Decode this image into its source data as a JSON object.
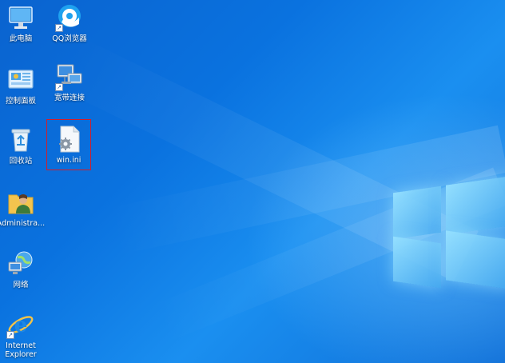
{
  "desktop": {
    "icons": [
      {
        "label": "此电脑",
        "icon": "this-pc-icon"
      },
      {
        "label": "QQ浏览器",
        "icon": "qq-browser-icon"
      },
      {
        "label": "控制面板",
        "icon": "control-panel-icon"
      },
      {
        "label": "宽带连接",
        "icon": "broadband-connection-icon"
      },
      {
        "label": "回收站",
        "icon": "recycle-bin-icon"
      },
      {
        "label": "win.ini",
        "icon": "config-file-icon"
      },
      {
        "label": "Administra...",
        "icon": "user-folder-icon"
      },
      {
        "label": "网络",
        "icon": "network-icon"
      },
      {
        "label": "Internet Explorer",
        "icon": "internet-explorer-icon"
      }
    ]
  },
  "colors": {
    "background": "#0a72df",
    "selection_border": "#d21f2a",
    "label_text": "#ffffff"
  }
}
